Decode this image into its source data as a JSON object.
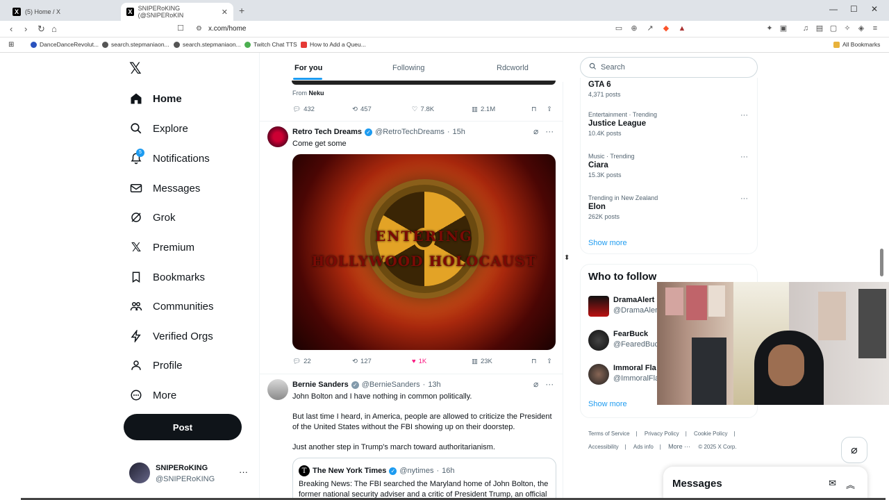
{
  "browser": {
    "tabs": [
      {
        "title": "(5) Home / X"
      },
      {
        "title": "SNIPERoKING (@SNIPERoKIN"
      }
    ],
    "url": "x.com/home",
    "bookmarks": [
      {
        "label": "DanceDanceRevolut...",
        "color": "#2a52be"
      },
      {
        "label": "search.stepmaniaon...",
        "color": "#555555"
      },
      {
        "label": "search.stepmaniaon...",
        "color": "#555555"
      },
      {
        "label": "Twitch Chat TTS",
        "color": "#4caf50"
      },
      {
        "label": "How to Add a Queu...",
        "color": "#e53935"
      }
    ],
    "all_bookmarks": "All Bookmarks"
  },
  "sidebar": {
    "items": [
      {
        "label": "Home",
        "icon": "home-icon"
      },
      {
        "label": "Explore",
        "icon": "search-icon"
      },
      {
        "label": "Notifications",
        "icon": "bell-icon",
        "badge": "5"
      },
      {
        "label": "Messages",
        "icon": "mail-icon"
      },
      {
        "label": "Grok",
        "icon": "grok-icon"
      },
      {
        "label": "Premium",
        "icon": "x-icon"
      },
      {
        "label": "Bookmarks",
        "icon": "bookmark-icon"
      },
      {
        "label": "Communities",
        "icon": "people-icon"
      },
      {
        "label": "Verified Orgs",
        "icon": "bolt-icon"
      },
      {
        "label": "Profile",
        "icon": "person-icon"
      },
      {
        "label": "More",
        "icon": "more-circle-icon"
      }
    ],
    "post_label": "Post",
    "profile": {
      "name": "SNIPERoKING",
      "handle": "@SNIPERoKING"
    }
  },
  "feed": {
    "tabs": [
      "For you",
      "Following",
      "Rdcworld"
    ],
    "prev_post": {
      "from_label": "From",
      "from_name": "Neku",
      "replies": "432",
      "reposts": "457",
      "likes": "7.8K",
      "views": "2.1M"
    },
    "post1": {
      "name": "Retro Tech Dreams",
      "handle": "@RetroTechDreams",
      "time": "15h",
      "text": "Come get some",
      "image_text1": "ENTERING",
      "image_text2": "HOLLYWOOD HOLOCAUST",
      "replies": "22",
      "reposts": "127",
      "likes": "1K",
      "views": "23K"
    },
    "post2": {
      "name": "Bernie Sanders",
      "handle": "@BernieSanders",
      "time": "13h",
      "line1": "John Bolton and I have nothing in common politically.",
      "line2": "But last time I heard, in America, people are allowed to criticize the President of the United States without the FBI showing up on their doorstep.",
      "line3": "Just another step in Trump's march toward authoritarianism.",
      "quote": {
        "name": "The New York Times",
        "handle": "@nytimes",
        "time": "16h",
        "text": "Breaking News: The FBI searched the Maryland home of John Bolton, the former national security adviser and a critic of President Trump, an official"
      }
    }
  },
  "right": {
    "search_placeholder": "Search",
    "trends": [
      {
        "category": "",
        "title": "GTA 6",
        "posts": "4,371 posts"
      },
      {
        "category": "Entertainment · Trending",
        "title": "Justice League",
        "posts": "10.4K posts"
      },
      {
        "category": "Music · Trending",
        "title": "Ciara",
        "posts": "15.3K posts"
      },
      {
        "category": "Trending in New Zealand",
        "title": "Elon",
        "posts": "262K posts"
      }
    ],
    "show_more": "Show more",
    "who_to_follow": "Who to follow",
    "follows": [
      {
        "name": "DramaAlert",
        "handle": "@DramaAler"
      },
      {
        "name": "FearBuck",
        "handle": "@FearedBuck"
      },
      {
        "name": "Immoral Fla",
        "handle": "@ImmoralFla"
      }
    ],
    "footer": [
      "Terms of Service",
      "Privacy Policy",
      "Cookie Policy",
      "Accessibility",
      "Ads info",
      "More ···",
      "© 2025 X Corp."
    ],
    "messages": "Messages"
  }
}
